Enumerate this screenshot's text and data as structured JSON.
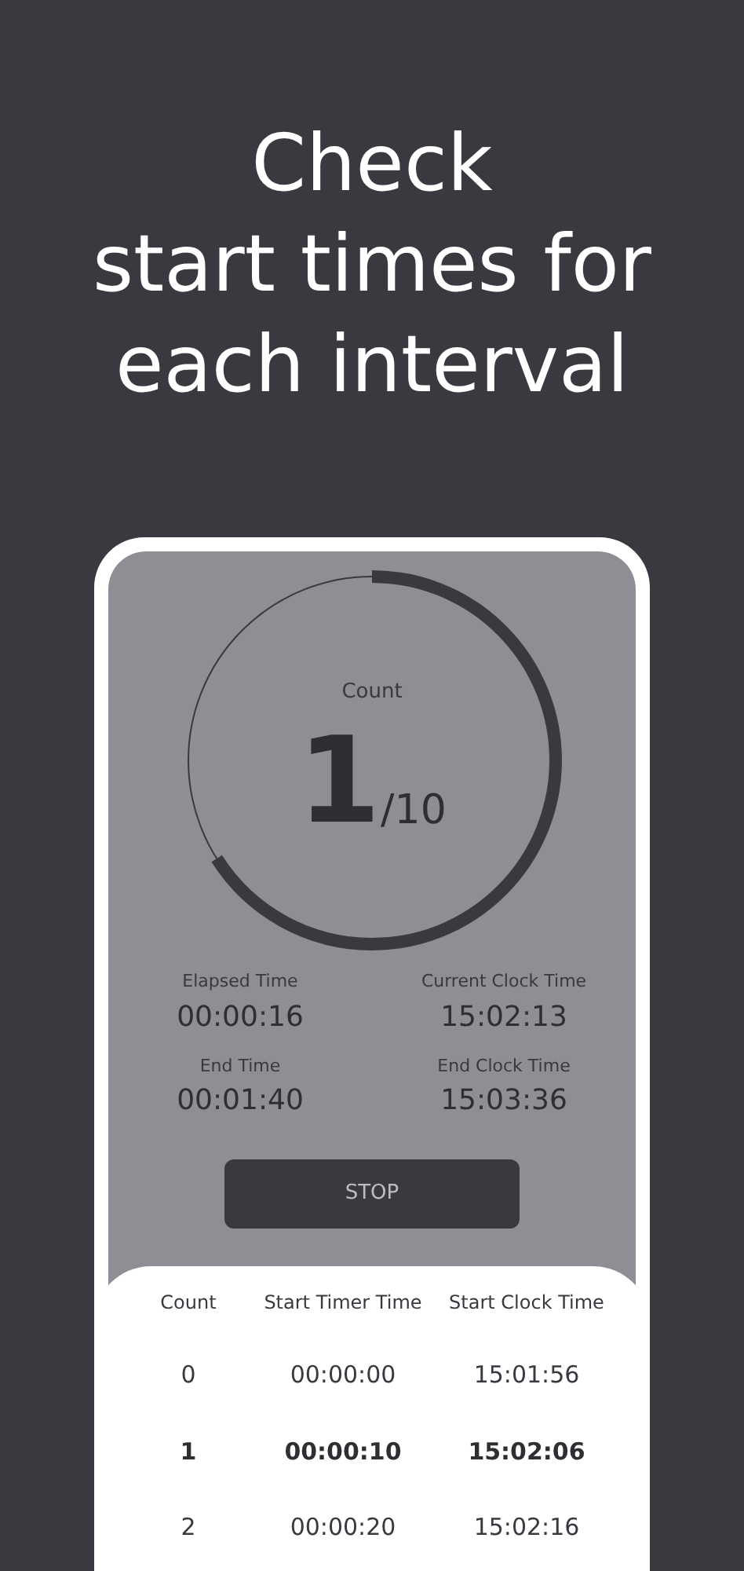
{
  "headline": "Check\nstart times for\neach interval",
  "timer": {
    "label": "Count",
    "count": "1",
    "total": "/10",
    "level": 0.66
  },
  "stats": [
    {
      "label": "Elapsed Time",
      "value": "00:00:16"
    },
    {
      "label": "Current Clock Time",
      "value": "15:02:13"
    },
    {
      "label": "End Time",
      "value": "00:01:40"
    },
    {
      "label": "End Clock Time",
      "value": "15:03:36"
    }
  ],
  "stop_button": "STOP",
  "table": {
    "columns": [
      "Count",
      "Start Timer Time",
      "Start Clock Time"
    ],
    "rows": [
      {
        "cells": [
          "0",
          "00:00:00",
          "15:01:56"
        ],
        "selected": false
      },
      {
        "cells": [
          "1",
          "00:00:10",
          "15:02:06"
        ],
        "selected": true
      },
      {
        "cells": [
          "2",
          "00:00:20",
          "15:02:16"
        ],
        "selected": false
      }
    ]
  }
}
